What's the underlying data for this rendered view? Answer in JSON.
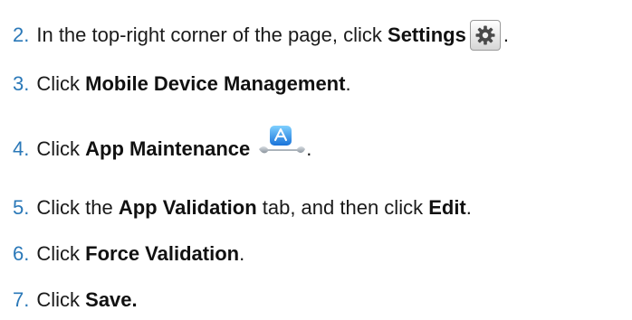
{
  "steps": [
    {
      "num": "2.",
      "parts": [
        {
          "t": "In the top-right corner of the page, click "
        },
        {
          "b": "Settings"
        },
        {
          "icon": "settings-gear-icon"
        },
        {
          "t": "."
        }
      ]
    },
    {
      "num": "3.",
      "parts": [
        {
          "t": "Click "
        },
        {
          "b": "Mobile Device Management"
        },
        {
          "t": "."
        }
      ]
    },
    {
      "num": "4.",
      "parts": [
        {
          "t": "Click "
        },
        {
          "b": "App Maintenance"
        },
        {
          "t": " "
        },
        {
          "icon": "app-maintenance-icon"
        },
        {
          "t": " ."
        }
      ]
    },
    {
      "num": "5.",
      "parts": [
        {
          "t": "Click the "
        },
        {
          "b": "App Validation"
        },
        {
          "t": " tab, and then click "
        },
        {
          "b": "Edit"
        },
        {
          "t": "."
        }
      ]
    },
    {
      "num": "6.",
      "parts": [
        {
          "t": "Click "
        },
        {
          "b": "Force Validation"
        },
        {
          "t": "."
        }
      ]
    },
    {
      "num": "7.",
      "parts": [
        {
          "t": "Click "
        },
        {
          "b": "Save."
        }
      ]
    }
  ],
  "colors": {
    "number": "#2a78b8",
    "text": "#1a1a1a"
  }
}
